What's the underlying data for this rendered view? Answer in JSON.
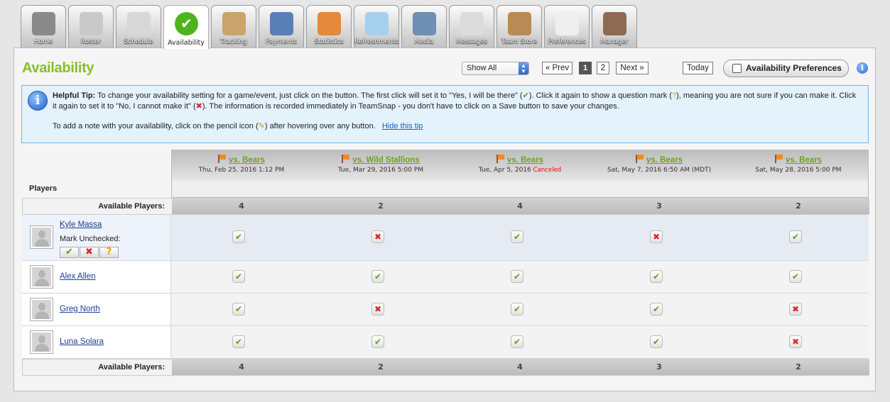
{
  "tabs": [
    {
      "label": "Home",
      "icon": "home-icon",
      "color": "#8a8a8a"
    },
    {
      "label": "Roster",
      "icon": "roster-icon",
      "color": "#c9c9c9"
    },
    {
      "label": "Schedule",
      "icon": "calendar-icon",
      "color": "#d8d8d8"
    },
    {
      "label": "Availability",
      "icon": "checkmark-icon",
      "color": "#4cb51c",
      "active": true
    },
    {
      "label": "Tracking",
      "icon": "clipboard-icon",
      "color": "#c9a46c"
    },
    {
      "label": "Payments",
      "icon": "wallet-icon",
      "color": "#5a7fb6"
    },
    {
      "label": "Statistics",
      "icon": "pie-chart-icon",
      "color": "#e38a3c"
    },
    {
      "label": "Refreshments",
      "icon": "water-glass-icon",
      "color": "#a6d0ee"
    },
    {
      "label": "Media",
      "icon": "photo-film-icon",
      "color": "#6f8fb3"
    },
    {
      "label": "Messages",
      "icon": "speech-bubble-icon",
      "color": "#dcdcdc"
    },
    {
      "label": "Team Store",
      "icon": "shopping-bag-icon",
      "color": "#b98a55"
    },
    {
      "label": "Preferences",
      "icon": "switch-icon",
      "color": "#efefef"
    },
    {
      "label": "Manager",
      "icon": "person-icon",
      "color": "#8d6b52"
    }
  ],
  "page": {
    "title": "Availability"
  },
  "filter": {
    "selected": "Show All"
  },
  "pagination": {
    "prev": "« Prev",
    "page1": "1",
    "page2": "2",
    "next": "Next »"
  },
  "today_label": "Today",
  "prefs_label": "Availability Preferences",
  "tip": {
    "bold": "Helpful Tip:",
    "text1": " To change your availability setting for a game/event, just click on the button. The first click will set it to \"Yes, I will be there\" (",
    "text2": "). Click it again to show a question mark (",
    "text3": "), meaning you are not sure if you can make it. Click it again to set it to \"No, I cannot make it\" (",
    "text4": "). The information is recorded immediately in TeamSnap - you don't have to click on a Save button to save your changes.",
    "line2": "To add a note with your availability, click on the pencil icon (",
    "line2b": ") after hovering over any button.",
    "hide": "Hide this tip"
  },
  "players_label": "Players",
  "available_label": "Available Players:",
  "events": [
    {
      "name": "vs. Bears",
      "date": "Thu, Feb 25, 2016 1:12 PM",
      "canceled": ""
    },
    {
      "name": "vs. Wild Stallions",
      "date": "Tue, Mar 29, 2016 5:00 PM",
      "canceled": ""
    },
    {
      "name": "vs. Bears",
      "date": "Tue, Apr 5, 2016",
      "canceled": "Canceled"
    },
    {
      "name": "vs. Bears",
      "date": "Sat, May 7, 2016 6:50 AM (MDT)",
      "canceled": ""
    },
    {
      "name": "vs. Bears",
      "date": "Sat, May 28, 2016 5:00 PM",
      "canceled": ""
    }
  ],
  "totals": [
    "4",
    "2",
    "4",
    "3",
    "2"
  ],
  "mark_unchecked": "Mark Unchecked:",
  "players": [
    {
      "name": "Kyle Massa",
      "status": [
        "yes",
        "no",
        "yes",
        "no",
        "yes"
      ]
    },
    {
      "name": "Alex Allen",
      "status": [
        "yes",
        "yes",
        "yes",
        "yes",
        "yes"
      ]
    },
    {
      "name": "Greg North",
      "status": [
        "yes",
        "no",
        "yes",
        "yes",
        "no"
      ]
    },
    {
      "name": "Luna Solara",
      "status": [
        "yes",
        "yes",
        "yes",
        "yes",
        "no"
      ]
    }
  ],
  "colors": {
    "accent_green": "#86bf27",
    "yes": "#5aa218",
    "no": "#d82a2a",
    "question": "#e0a800",
    "link": "#1a3f8f"
  }
}
